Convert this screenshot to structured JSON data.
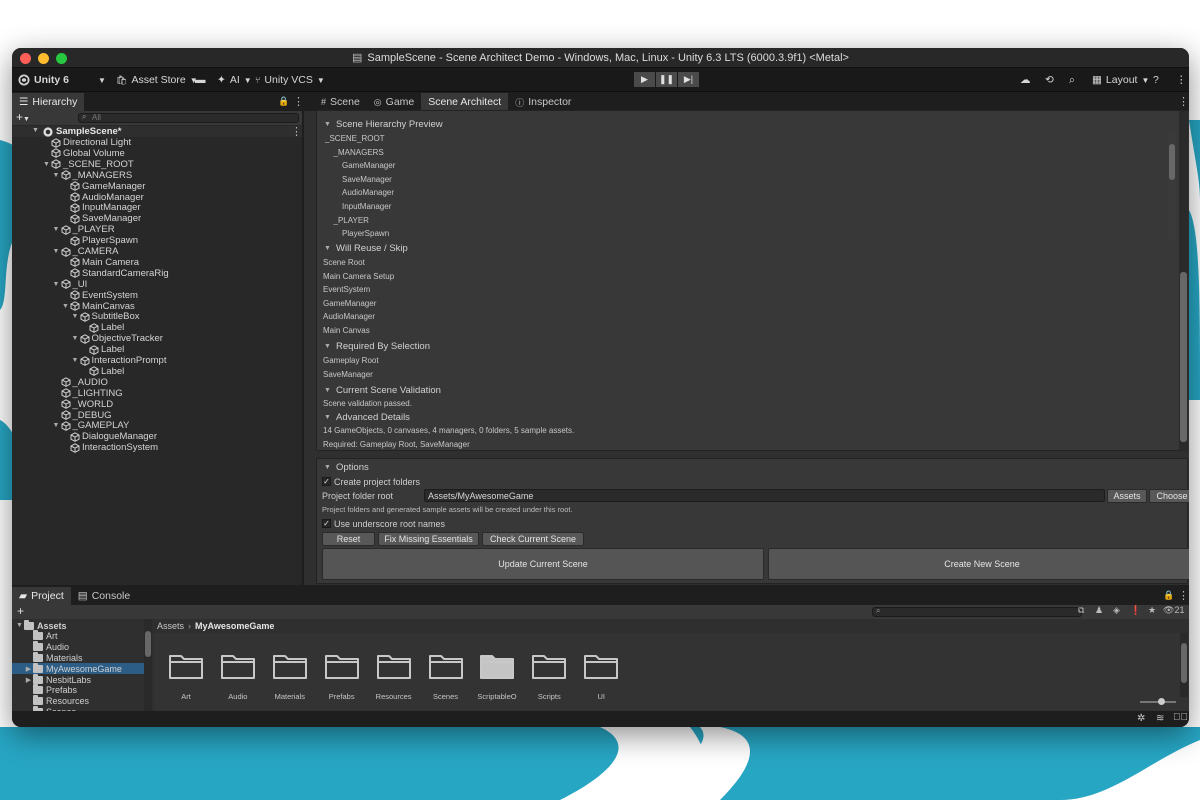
{
  "window": {
    "title": "SampleScene - Scene Architect Demo - Windows, Mac, Linux - Unity 6.3 LTS (6000.3.9f1) <Metal>"
  },
  "colors": {
    "close": "#ff5f57",
    "minimize": "#febc2e",
    "maximize": "#28c840",
    "background_wave": "#27a6c4",
    "selection": "#2c5d87"
  },
  "toolbar": {
    "account": "Unity 6",
    "asset_store": "Asset Store",
    "ai": "AI",
    "vcs": "Unity VCS",
    "layout": "Layout",
    "icons": [
      "unity-logo-icon",
      "chevron-down-icon",
      "shopping-bag-icon",
      "archive-icon",
      "sparkle-icon",
      "branch-icon",
      "play-icon",
      "pause-icon",
      "step-icon",
      "cloud-icon",
      "history-icon",
      "search-icon",
      "layout-icon",
      "help-icon",
      "more-icon"
    ]
  },
  "hierarchy": {
    "tab": "Hierarchy",
    "search_placeholder": "All",
    "scene": "SampleScene*",
    "items": [
      {
        "label": "Directional Light",
        "depth": 1,
        "arrow": false
      },
      {
        "label": "Global Volume",
        "depth": 1,
        "arrow": false
      },
      {
        "label": "_SCENE_ROOT",
        "depth": 1,
        "arrow": true
      },
      {
        "label": "_MANAGERS",
        "depth": 2,
        "arrow": true
      },
      {
        "label": "GameManager",
        "depth": 3,
        "arrow": false
      },
      {
        "label": "AudioManager",
        "depth": 3,
        "arrow": false
      },
      {
        "label": "InputManager",
        "depth": 3,
        "arrow": false
      },
      {
        "label": "SaveManager",
        "depth": 3,
        "arrow": false
      },
      {
        "label": "_PLAYER",
        "depth": 2,
        "arrow": true
      },
      {
        "label": "PlayerSpawn",
        "depth": 3,
        "arrow": false
      },
      {
        "label": "_CAMERA",
        "depth": 2,
        "arrow": true
      },
      {
        "label": "Main Camera",
        "depth": 3,
        "arrow": false
      },
      {
        "label": "StandardCameraRig",
        "depth": 3,
        "arrow": false
      },
      {
        "label": "_UI",
        "depth": 2,
        "arrow": true
      },
      {
        "label": "EventSystem",
        "depth": 3,
        "arrow": false
      },
      {
        "label": "MainCanvas",
        "depth": 3,
        "arrow": true
      },
      {
        "label": "SubtitleBox",
        "depth": 4,
        "arrow": true
      },
      {
        "label": "Label",
        "depth": 5,
        "arrow": false
      },
      {
        "label": "ObjectiveTracker",
        "depth": 4,
        "arrow": true
      },
      {
        "label": "Label",
        "depth": 5,
        "arrow": false
      },
      {
        "label": "InteractionPrompt",
        "depth": 4,
        "arrow": true
      },
      {
        "label": "Label",
        "depth": 5,
        "arrow": false
      },
      {
        "label": "_AUDIO",
        "depth": 2,
        "arrow": false
      },
      {
        "label": "_LIGHTING",
        "depth": 2,
        "arrow": false
      },
      {
        "label": "_WORLD",
        "depth": 2,
        "arrow": false
      },
      {
        "label": "_DEBUG",
        "depth": 2,
        "arrow": false
      },
      {
        "label": "_GAMEPLAY",
        "depth": 2,
        "arrow": true
      },
      {
        "label": "DialogueManager",
        "depth": 3,
        "arrow": false
      },
      {
        "label": "InteractionSystem",
        "depth": 3,
        "arrow": false
      }
    ]
  },
  "center_tabs": [
    {
      "label": "Scene",
      "icon": "grid-icon"
    },
    {
      "label": "Game",
      "icon": "gamepad-icon"
    },
    {
      "label": "Scene Architect",
      "icon": "",
      "active": true
    },
    {
      "label": "Inspector",
      "icon": "info-icon"
    }
  ],
  "scene_architect": {
    "sections": {
      "preview": "Scene Hierarchy Preview",
      "reuse": "Will Reuse / Skip",
      "required": "Required By Selection",
      "validation": "Current Scene Validation",
      "advanced": "Advanced Details"
    },
    "preview_items": [
      {
        "label": "_SCENE_ROOT",
        "indent": 0
      },
      {
        "label": "_MANAGERS",
        "indent": 1
      },
      {
        "label": "GameManager",
        "indent": 2
      },
      {
        "label": "SaveManager",
        "indent": 2
      },
      {
        "label": "AudioManager",
        "indent": 2
      },
      {
        "label": "InputManager",
        "indent": 2
      },
      {
        "label": "_PLAYER",
        "indent": 1
      },
      {
        "label": "PlayerSpawn",
        "indent": 2
      }
    ],
    "reuse_items": [
      "Scene Root",
      "Main Camera Setup",
      "EventSystem",
      "GameManager",
      "AudioManager",
      "Main Canvas"
    ],
    "required_items": [
      "Gameplay Root",
      "SaveManager"
    ],
    "validation_text": "Scene validation passed.",
    "advanced_lines": [
      "14 GameObjects, 0 canvases, 4 managers, 0 folders, 5 sample assets.",
      "Required: Gameplay Root, SaveManager"
    ]
  },
  "options": {
    "title": "Options",
    "create_folders": "Create project folders",
    "folder_root_label": "Project folder root",
    "folder_root_value": "Assets/MyAwesomeGame",
    "assets_button": "Assets",
    "choose_button": "Choose",
    "folders_note": "Project folders and generated sample assets will be created under this root.",
    "underscore": "Use underscore root names",
    "reset": "Reset",
    "fix": "Fix Missing Essentials",
    "check": "Check Current Scene",
    "update": "Update Current Scene",
    "create": "Create New Scene"
  },
  "project": {
    "tab_project": "Project",
    "tab_console": "Console",
    "hidden_count": "21",
    "breadcrumb_root": "Assets",
    "breadcrumb_current": "MyAwesomeGame",
    "tree": [
      {
        "label": "Assets",
        "depth": 0,
        "bold": true,
        "arrow": true
      },
      {
        "label": "Art",
        "depth": 1,
        "arrow": false
      },
      {
        "label": "Audio",
        "depth": 1,
        "arrow": false
      },
      {
        "label": "Materials",
        "depth": 1,
        "arrow": false
      },
      {
        "label": "MyAwesomeGame",
        "depth": 1,
        "arrow": true,
        "selected": true
      },
      {
        "label": "NesbitLabs",
        "depth": 1,
        "arrow": true
      },
      {
        "label": "Prefabs",
        "depth": 1,
        "arrow": false
      },
      {
        "label": "Resources",
        "depth": 1,
        "arrow": false
      },
      {
        "label": "Scenes",
        "depth": 1,
        "arrow": false
      }
    ],
    "folders": [
      {
        "label": "Art"
      },
      {
        "label": "Audio"
      },
      {
        "label": "Materials"
      },
      {
        "label": "Prefabs"
      },
      {
        "label": "Resources"
      },
      {
        "label": "Scenes"
      },
      {
        "label": "ScriptableO...",
        "filled": true
      },
      {
        "label": "Scripts"
      },
      {
        "label": "UI"
      }
    ]
  }
}
